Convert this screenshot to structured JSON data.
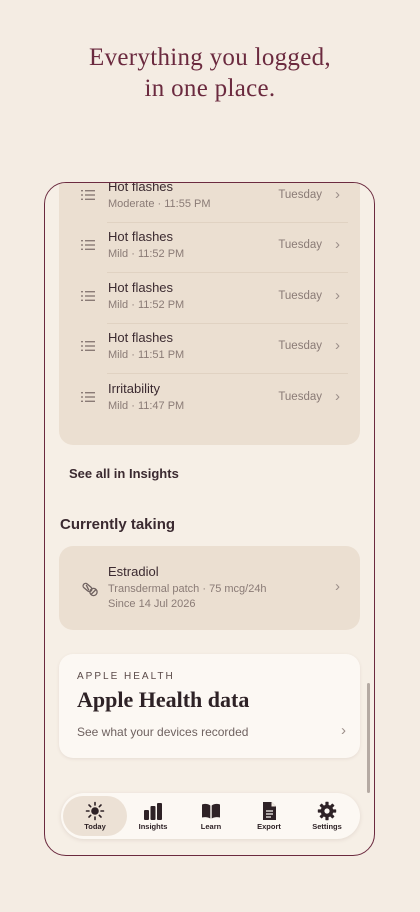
{
  "headline": {
    "line1": "Everything you logged,",
    "line2": "in one place."
  },
  "logs": [
    {
      "title": "Hot flashes",
      "detail": "Moderate · 11:55 PM",
      "day": "Tuesday"
    },
    {
      "title": "Hot flashes",
      "detail": "Mild · 11:52 PM",
      "day": "Tuesday"
    },
    {
      "title": "Hot flashes",
      "detail": "Mild · 11:52 PM",
      "day": "Tuesday"
    },
    {
      "title": "Hot flashes",
      "detail": "Mild · 11:51 PM",
      "day": "Tuesday"
    },
    {
      "title": "Irritability",
      "detail": "Mild · 11:47 PM",
      "day": "Tuesday"
    }
  ],
  "see_all_label": "See all in Insights",
  "currently_taking": {
    "title": "Currently taking",
    "medication": {
      "name": "Estradiol",
      "dose": "Transdermal patch · 75 mcg/24h",
      "since": "Since 14 Jul 2026"
    }
  },
  "apple_health": {
    "eyebrow": "APPLE HEALTH",
    "title": "Apple Health data",
    "subtitle": "See what your devices recorded"
  },
  "tabs": [
    {
      "label": "Today",
      "icon": "sun-icon",
      "active": true
    },
    {
      "label": "Insights",
      "icon": "bar-chart-icon",
      "active": false
    },
    {
      "label": "Learn",
      "icon": "book-icon",
      "active": false
    },
    {
      "label": "Export",
      "icon": "document-icon",
      "active": false
    },
    {
      "label": "Settings",
      "icon": "gear-icon",
      "active": false
    }
  ],
  "colors": {
    "accent": "#6b2a3f",
    "background": "#f4ece3",
    "card": "#ebdfd1"
  }
}
